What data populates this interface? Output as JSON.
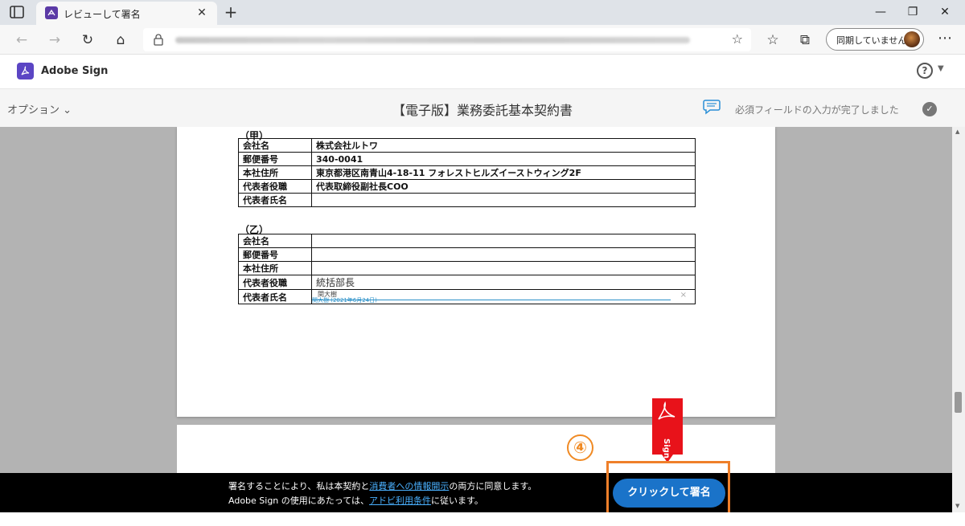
{
  "browser": {
    "tab_title": "レビューして署名",
    "tab_close": "✕",
    "new_tab": "+",
    "sync_label": "同期していません",
    "window_min": "—",
    "window_max": "❐",
    "window_close": "✕"
  },
  "app": {
    "name": "Adobe Sign",
    "help": "?"
  },
  "toolbar": {
    "options_label": "オプション",
    "document_title": "【電子版】業務委託基本契約書",
    "status_text": "必須フィールドの入力が完了しました"
  },
  "party_a": {
    "heading": "（甲）",
    "rows": [
      {
        "key": "会社名",
        "value": "株式会社ルトワ"
      },
      {
        "key": "郵便番号",
        "value": "340-0041"
      },
      {
        "key": "本社住所",
        "value": "東京都港区南青山4-18-11 フォレストヒルズイーストウィング2F"
      },
      {
        "key": "代表者役職",
        "value": "代表取締役副社長COO"
      },
      {
        "key": "代表者氏名",
        "value": ""
      }
    ]
  },
  "party_b": {
    "heading": "（乙）",
    "rows": [
      {
        "key": "会社名",
        "value": ""
      },
      {
        "key": "郵便番号",
        "value": ""
      },
      {
        "key": "本社住所",
        "value": ""
      },
      {
        "key": "代表者役職",
        "value": "統括部長"
      },
      {
        "key": "代表者氏名",
        "value": ""
      }
    ],
    "signature_name": "関大樹",
    "signature_date": "関大樹 (2021年6月24日)"
  },
  "sign_flag": "Sign",
  "step_marker": "④",
  "footer": {
    "line1_pre": "署名することにより、私は本契約と",
    "line1_link": "消費者への情報開示",
    "line1_post": "の両方に同意します。",
    "line2_pre": "Adobe Sign の使用にあたっては、",
    "line2_link": "アドビ利用条件",
    "line2_post": "に従います。",
    "sign_button": "クリックして署名"
  },
  "colors": {
    "accent_blue": "#1a73c9",
    "highlight_orange": "#ef7f2a",
    "adobe_red": "#e8121a"
  }
}
